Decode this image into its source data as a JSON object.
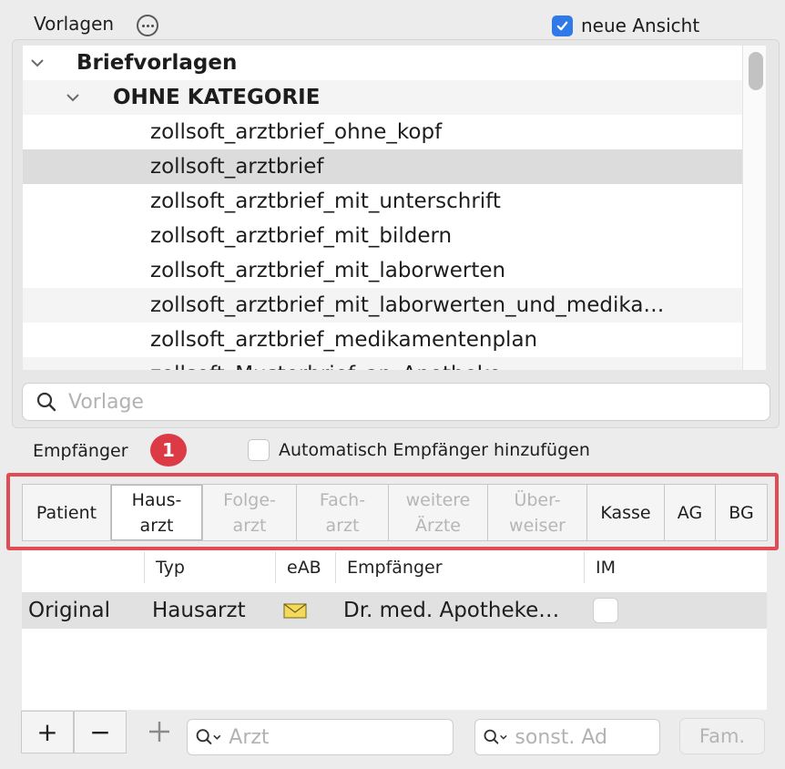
{
  "header": {
    "title": "Vorlagen",
    "neue_ansicht_label": "neue Ansicht",
    "neue_ansicht_checked": true
  },
  "tree": {
    "root_label": "Briefvorlagen",
    "category_label": "OHNE KATEGORIE",
    "items": [
      "zollsoft_arztbrief_ohne_kopf",
      "zollsoft_arztbrief",
      "zollsoft_arztbrief_mit_unterschrift",
      "zollsoft_arztbrief_mit_bildern",
      "zollsoft_arztbrief_mit_laborwerten",
      "zollsoft_arztbrief_mit_laborwerten_und_medika…",
      "zollsoft_arztbrief_medikamentenplan",
      "zollsoft_Musterbrief_an_Apotheke"
    ],
    "selected_index": 1
  },
  "search": {
    "placeholder": "Vorlage"
  },
  "recipients": {
    "label": "Empfänger",
    "badge": "1",
    "auto_add_label": "Automatisch Empfänger hinzufügen",
    "auto_add_checked": false,
    "tabs": [
      {
        "line1": "Patient",
        "line2": ""
      },
      {
        "line1": "Haus-",
        "line2": "arzt"
      },
      {
        "line1": "Folge-",
        "line2": "arzt"
      },
      {
        "line1": "Fach-",
        "line2": "arzt"
      },
      {
        "line1": "weitere",
        "line2": "Ärzte"
      },
      {
        "line1": "Über-",
        "line2": "weiser"
      },
      {
        "line1": "Kasse",
        "line2": ""
      },
      {
        "line1": "AG",
        "line2": ""
      },
      {
        "line1": "BG",
        "line2": ""
      }
    ],
    "table": {
      "columns": [
        "Typ",
        "eAB",
        "Empfänger",
        "IM"
      ],
      "rows": [
        {
          "kind": "Original",
          "typ": "Hausarzt",
          "eab": "envelope-icon",
          "empfaenger": "Dr. med. Apotheke…",
          "im": false
        }
      ]
    }
  },
  "toolbar": {
    "add_label": "+",
    "remove_label": "−",
    "add_plain_label": "+",
    "arzt_placeholder": "Arzt",
    "sonst_placeholder": "sonst. Ad",
    "fam_label": "Fam."
  },
  "colors": {
    "accent": "#2f79e8",
    "badge": "#dc3a45",
    "highlight_border": "#e04c55"
  }
}
